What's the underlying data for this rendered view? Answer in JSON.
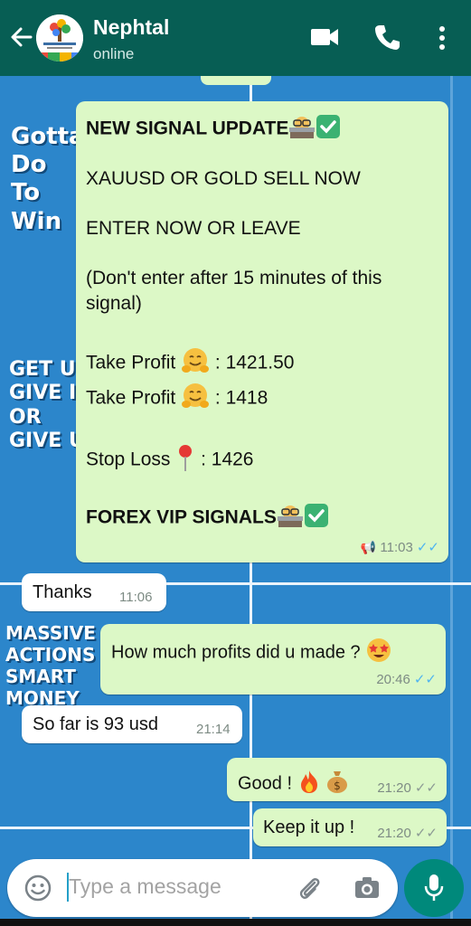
{
  "header": {
    "contact_name": "Nephtal",
    "status": "online"
  },
  "background_text": {
    "block1": [
      "Gotta",
      "Do",
      "To",
      "Win"
    ],
    "block2": [
      "GET UP",
      "GIVE IT",
      "OR",
      "GIVE UP"
    ],
    "block3": [
      "MASSIVE",
      "ACTIONS",
      "SMART",
      "MONEY"
    ]
  },
  "messages": {
    "signal": {
      "title": "NEW SIGNAL UPDATE",
      "line1": "XAUUSD OR GOLD SELL NOW",
      "line2": "ENTER NOW OR LEAVE",
      "line3a": "(Don't enter after 15 minutes of this",
      "line3b": "signal)",
      "tp1_label": "Take Profit",
      "tp1_value": ": 1421.50",
      "tp2_label": "Take Profit",
      "tp2_value": ": 1418",
      "sl_label": "Stop Loss",
      "sl_value": ": 1426",
      "footer": "FOREX VIP SIGNALS",
      "time": "11:03"
    },
    "thanks": {
      "text": "Thanks",
      "time": "11:06"
    },
    "profits": {
      "text": "How much profits did u made ?",
      "time": "20:46"
    },
    "sofar": {
      "text": "So far is 93 usd",
      "time": "21:14"
    },
    "good": {
      "text": "Good !",
      "time": "21:20"
    },
    "keepitup": {
      "text": "Keep it up !",
      "time": "21:20"
    }
  },
  "input": {
    "placeholder": "Type a message"
  },
  "colors": {
    "header": "#075e54",
    "outgoing_bubble": "#dcf8c6",
    "incoming_bubble": "#ffffff",
    "read_ticks": "#4fb4f0",
    "mic_button": "#00897b"
  }
}
